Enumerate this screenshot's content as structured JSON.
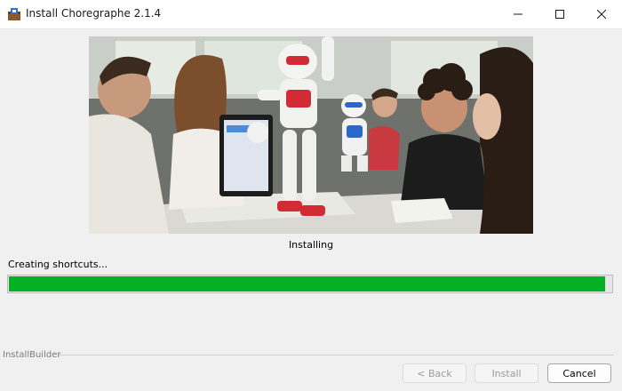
{
  "window": {
    "title": "Install Choregraphe 2.1.4",
    "icon": "installer-package-icon",
    "controls": [
      "minimize-icon",
      "maximize-icon",
      "close-icon"
    ]
  },
  "hero_image": {
    "description_icon": "students-with-nao-robots-photo"
  },
  "status": "Installing",
  "substatus": "Creating shortcuts...",
  "progress": {
    "percent": 99,
    "color": "#06b025"
  },
  "branding": "InstallBuilder",
  "buttons": {
    "back": "< Back",
    "install": "Install",
    "cancel": "Cancel"
  }
}
